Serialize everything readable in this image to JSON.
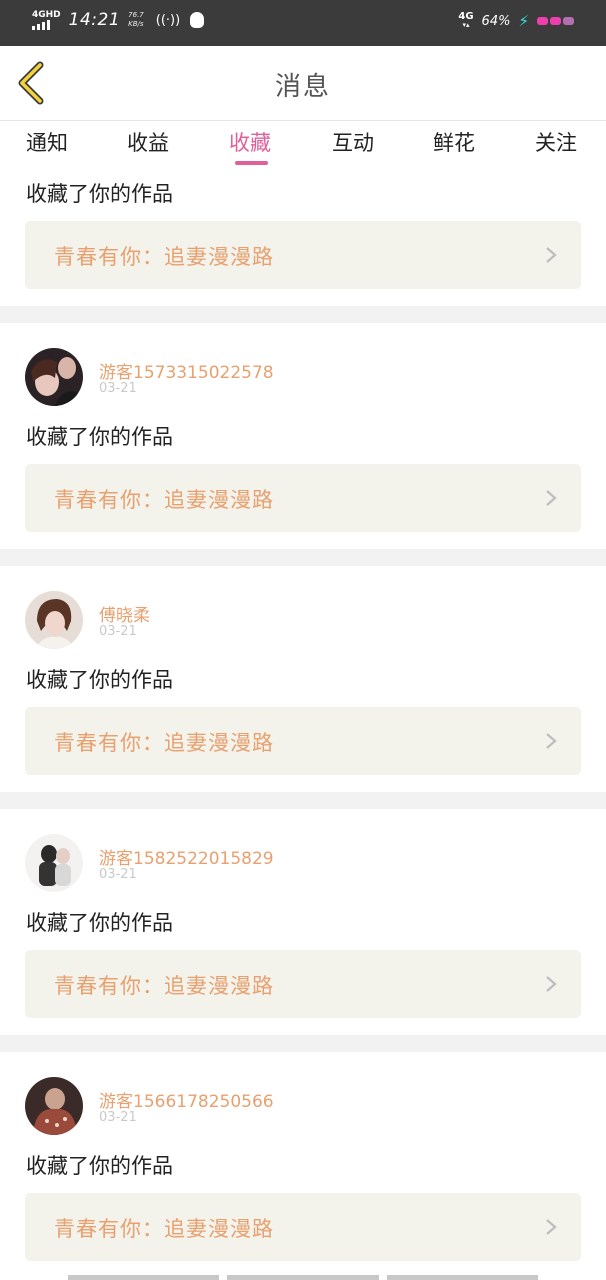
{
  "status_bar": {
    "network": "4GHD",
    "time": "14:21",
    "speed_value": "76.7",
    "speed_unit": "KB/s",
    "network_right": "4G",
    "battery": "64%"
  },
  "header": {
    "title": "消息"
  },
  "tabs": [
    {
      "label": "通知",
      "active": false
    },
    {
      "label": "收益",
      "active": false
    },
    {
      "label": "收藏",
      "active": true
    },
    {
      "label": "互动",
      "active": false
    },
    {
      "label": "鲜花",
      "active": false
    },
    {
      "label": "关注",
      "active": false
    }
  ],
  "colors": {
    "accent_pink": "#e0609c",
    "name_orange": "#e8a06f",
    "card_bg": "#f3f3ec"
  },
  "notifications": [
    {
      "user": "",
      "date": "",
      "action": "收藏了你的作品",
      "work": "青春有你：追妻漫漫路"
    },
    {
      "user": "游客15733150225​78",
      "date": "03-21",
      "action": "收藏了你的作品",
      "work": "青春有你：追妻漫漫路"
    },
    {
      "user": "傅晓柔",
      "date": "03-21",
      "action": "收藏了你的作品",
      "work": "青春有你：追妻漫漫路"
    },
    {
      "user": "游客15825220158​29",
      "date": "03-21",
      "action": "收藏了你的作品",
      "work": "青春有你：追妻漫漫路"
    },
    {
      "user": "游客15661782505​66",
      "date": "03-21",
      "action": "收藏了你的作品",
      "work": "青春有你：追妻漫漫路"
    }
  ]
}
